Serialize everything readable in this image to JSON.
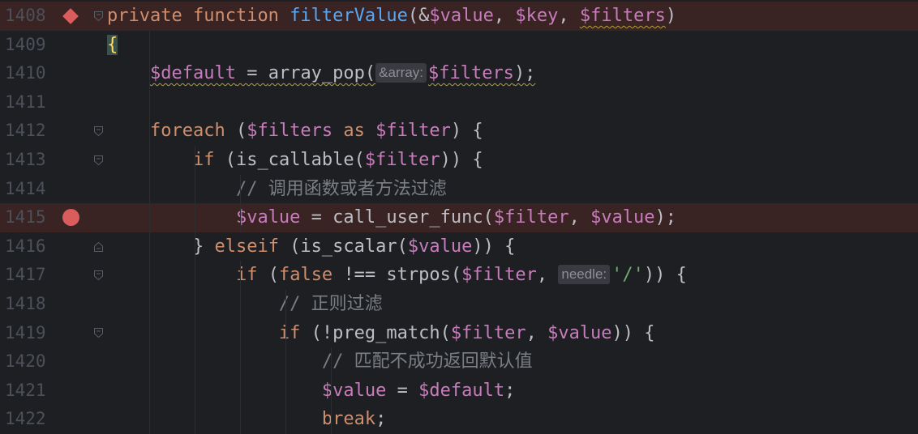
{
  "editor": {
    "lines": [
      {
        "num": "1408",
        "highlight": true,
        "marker": "diamond",
        "fold": "open",
        "indent": "",
        "tokens": [
          {
            "t": "private ",
            "c": "kw"
          },
          {
            "t": "function ",
            "c": "kw"
          },
          {
            "t": "filterValue",
            "c": "fnd"
          },
          {
            "t": "(&",
            "c": "p"
          },
          {
            "t": "$value",
            "c": "var"
          },
          {
            "t": ", ",
            "c": "p"
          },
          {
            "t": "$key",
            "c": "var"
          },
          {
            "t": ", ",
            "c": "p"
          },
          {
            "t": "$filters",
            "c": "var squig"
          },
          {
            "t": ")",
            "c": "p"
          }
        ]
      },
      {
        "num": "1409",
        "indent": "",
        "tokens": [
          {
            "t": "{",
            "c": "brace-hl"
          }
        ]
      },
      {
        "num": "1410",
        "indent": "    ",
        "tokens": [
          {
            "t": "$default",
            "c": "var squig"
          },
          {
            "t": " = ",
            "c": "p squig"
          },
          {
            "t": "array_pop",
            "c": "p squig"
          },
          {
            "t": "(",
            "c": "p squig"
          },
          {
            "t": "&array:",
            "c": "hint"
          },
          {
            "t": "$filters",
            "c": "var squig"
          },
          {
            "t": ");",
            "c": "p squig"
          }
        ]
      },
      {
        "num": "1411",
        "indent": "",
        "tokens": []
      },
      {
        "num": "1412",
        "fold": "open",
        "indent": "    ",
        "tokens": [
          {
            "t": "foreach ",
            "c": "kw"
          },
          {
            "t": "(",
            "c": "p"
          },
          {
            "t": "$filters",
            "c": "var"
          },
          {
            "t": " as ",
            "c": "kw"
          },
          {
            "t": "$filter",
            "c": "var"
          },
          {
            "t": ") {",
            "c": "p"
          }
        ]
      },
      {
        "num": "1413",
        "fold": "open",
        "indent": "        ",
        "tokens": [
          {
            "t": "if ",
            "c": "kw"
          },
          {
            "t": "(is_callable(",
            "c": "p"
          },
          {
            "t": "$filter",
            "c": "var"
          },
          {
            "t": ")) {",
            "c": "p"
          }
        ]
      },
      {
        "num": "1414",
        "indent": "            ",
        "tokens": [
          {
            "t": "// 调用函数或者方法过滤",
            "c": "cm"
          }
        ]
      },
      {
        "num": "1415",
        "highlight": true,
        "marker": "dot",
        "indent": "            ",
        "tokens": [
          {
            "t": "$value",
            "c": "var"
          },
          {
            "t": " = call_user_func(",
            "c": "p"
          },
          {
            "t": "$filter",
            "c": "var"
          },
          {
            "t": ", ",
            "c": "p"
          },
          {
            "t": "$value",
            "c": "var"
          },
          {
            "t": ");",
            "c": "p"
          }
        ]
      },
      {
        "num": "1416",
        "fold": "close",
        "indent": "        ",
        "tokens": [
          {
            "t": "} ",
            "c": "p"
          },
          {
            "t": "elseif ",
            "c": "kw"
          },
          {
            "t": "(is_scalar(",
            "c": "p"
          },
          {
            "t": "$value",
            "c": "var"
          },
          {
            "t": ")) {",
            "c": "p"
          }
        ]
      },
      {
        "num": "1417",
        "fold": "open",
        "indent": "            ",
        "tokens": [
          {
            "t": "if ",
            "c": "kw"
          },
          {
            "t": "(",
            "c": "p"
          },
          {
            "t": "false ",
            "c": "kw"
          },
          {
            "t": "!== strpos(",
            "c": "p"
          },
          {
            "t": "$filter",
            "c": "var"
          },
          {
            "t": ", ",
            "c": "p"
          },
          {
            "t": "needle:",
            "c": "hint"
          },
          {
            "t": "'/'",
            "c": "str"
          },
          {
            "t": ")) {",
            "c": "p"
          }
        ]
      },
      {
        "num": "1418",
        "indent": "                ",
        "tokens": [
          {
            "t": "// 正则过滤",
            "c": "cm"
          }
        ]
      },
      {
        "num": "1419",
        "fold": "open",
        "indent": "                ",
        "tokens": [
          {
            "t": "if ",
            "c": "kw"
          },
          {
            "t": "(!preg_match(",
            "c": "p"
          },
          {
            "t": "$filter",
            "c": "var"
          },
          {
            "t": ", ",
            "c": "p"
          },
          {
            "t": "$value",
            "c": "var"
          },
          {
            "t": ")) {",
            "c": "p"
          }
        ]
      },
      {
        "num": "1420",
        "indent": "                    ",
        "tokens": [
          {
            "t": "// 匹配不成功返回默认值",
            "c": "cm"
          }
        ]
      },
      {
        "num": "1421",
        "indent": "                    ",
        "tokens": [
          {
            "t": "$value",
            "c": "var"
          },
          {
            "t": " = ",
            "c": "p"
          },
          {
            "t": "$default",
            "c": "var"
          },
          {
            "t": ";",
            "c": "p"
          }
        ]
      },
      {
        "num": "1422",
        "indent": "                    ",
        "tokens": [
          {
            "t": "break",
            "c": "kw"
          },
          {
            "t": ";",
            "c": "p"
          }
        ]
      }
    ]
  }
}
